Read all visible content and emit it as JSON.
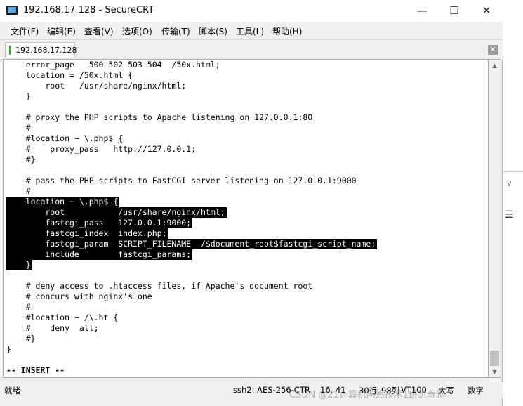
{
  "window": {
    "title": "192.168.17.128 - SecureCRT",
    "minimize": "—",
    "maximize": "☐",
    "close": "✕"
  },
  "menu": [
    {
      "label": "文件(F)"
    },
    {
      "label": "编辑(E)"
    },
    {
      "label": "查看(V)"
    },
    {
      "label": "选项(O)"
    },
    {
      "label": "传输(T)"
    },
    {
      "label": "脚本(S)"
    },
    {
      "label": "工具(L)"
    },
    {
      "label": "帮助(H)"
    }
  ],
  "tab": {
    "label": "192.168.17.128",
    "close_glyph": "✕",
    "status_color": "#2bb52b"
  },
  "terminal": {
    "lines": [
      {
        "text": "    error_page   500 502 503 504  /50x.html;",
        "sel": false
      },
      {
        "text": "    location = /50x.html {",
        "sel": false
      },
      {
        "text": "        root   /usr/share/nginx/html;",
        "sel": false
      },
      {
        "text": "    }",
        "sel": false
      },
      {
        "text": "",
        "sel": false
      },
      {
        "text": "    # proxy the PHP scripts to Apache listening on 127.0.0.1:80",
        "sel": false
      },
      {
        "text": "    #",
        "sel": false
      },
      {
        "text": "    #location ~ \\.php$ {",
        "sel": false
      },
      {
        "text": "    #    proxy_pass   http://127.0.0.1;",
        "sel": false
      },
      {
        "text": "    #}",
        "sel": false
      },
      {
        "text": "",
        "sel": false
      },
      {
        "text": "    # pass the PHP scripts to FastCGI server listening on 127.0.0.1:9000",
        "sel": false
      },
      {
        "text": "    #",
        "sel": false
      },
      {
        "text": "    location ~ \\.php$ {",
        "sel": true
      },
      {
        "text": "        root           /usr/share/nginx/html;",
        "sel": true
      },
      {
        "text": "        fastcgi_pass   127.0.0.1:9000;",
        "sel": true
      },
      {
        "text": "        fastcgi_index  index.php;",
        "sel": true
      },
      {
        "text": "        fastcgi_param  SCRIPT_FILENAME  /$document_root$fastcgi_script_name;",
        "sel": true
      },
      {
        "text": "        include        fastcgi_params;",
        "sel": true
      },
      {
        "text": "    }",
        "sel": true
      },
      {
        "text": "",
        "sel": false
      },
      {
        "text": "    # deny access to .htaccess files, if Apache's document root",
        "sel": false
      },
      {
        "text": "    # concurs with nginx's one",
        "sel": false
      },
      {
        "text": "    #",
        "sel": false
      },
      {
        "text": "    #location ~ /\\.ht {",
        "sel": false
      },
      {
        "text": "    #    deny  all;",
        "sel": false
      },
      {
        "text": "    #}",
        "sel": false
      },
      {
        "text": "}",
        "sel": false
      },
      {
        "text": "",
        "sel": false
      },
      {
        "text": "-- INSERT --",
        "sel": false,
        "bold": true
      }
    ]
  },
  "status": {
    "ready": "就绪",
    "session": "ssh2: AES-256-CTR",
    "cursor": "16,  41",
    "rows": "30行,",
    "cols": "98列",
    "term": "VT100",
    "caps": "大写",
    "num": "数字"
  },
  "watermark": "CSDN @21计算机网络技术1班洪寿鹏",
  "colors": {
    "selection_bg": "#000000",
    "selection_fg": "#ffffff",
    "titlebar_bg": "#ffffff",
    "chrome_bg": "#f0f0f0"
  }
}
